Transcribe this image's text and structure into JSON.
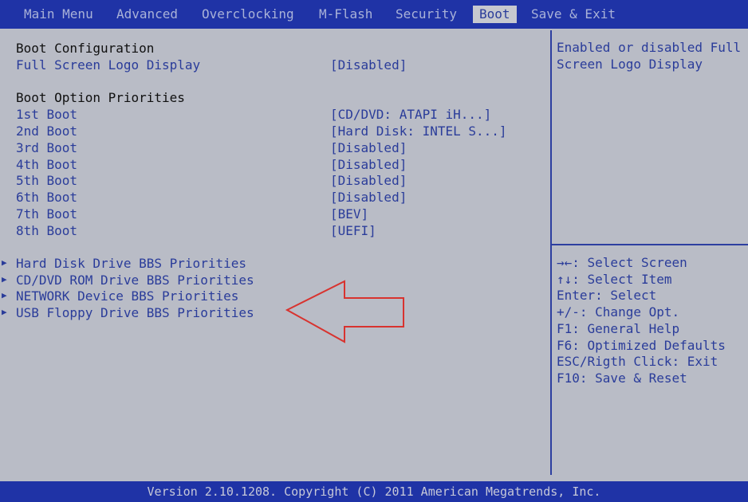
{
  "menu": {
    "items": [
      "Main Menu",
      "Advanced",
      "Overclocking",
      "M-Flash",
      "Security",
      "Boot",
      "Save & Exit"
    ],
    "active": "Boot"
  },
  "boot": {
    "config_header": "Boot Configuration",
    "full_screen_logo": {
      "label": "Full Screen Logo Display",
      "value": "[Disabled]"
    },
    "priorities_header": "Boot Option Priorities",
    "boot_options": [
      {
        "label": "1st Boot",
        "value": "[CD/DVD: ATAPI   iH...]"
      },
      {
        "label": "2nd Boot",
        "value": "[Hard Disk: INTEL S...]"
      },
      {
        "label": "3rd Boot",
        "value": "[Disabled]"
      },
      {
        "label": "4th Boot",
        "value": "[Disabled]"
      },
      {
        "label": "5th Boot",
        "value": "[Disabled]"
      },
      {
        "label": "6th Boot",
        "value": "[Disabled]"
      },
      {
        "label": "7th Boot",
        "value": "[BEV]"
      },
      {
        "label": "8th Boot",
        "value": "[UEFI]"
      }
    ],
    "submenus": [
      "Hard Disk Drive BBS Priorities",
      "CD/DVD ROM Drive BBS Priorities",
      "NETWORK Device BBS Priorities",
      "USB Floppy Drive BBS Priorities"
    ]
  },
  "help": {
    "description_line1": "Enabled or disabled Full",
    "description_line2": "Screen Logo Display",
    "keys": [
      "→←: Select Screen",
      "↑↓: Select Item",
      "Enter: Select",
      "+/-: Change Opt.",
      "F1: General Help",
      "F6: Optimized Defaults",
      "ESC/Rigth Click: Exit",
      "F10: Save & Reset"
    ]
  },
  "footer": {
    "text": "Version 2.10.1208. Copyright (C) 2011 American Megatrends, Inc."
  },
  "colors": {
    "menubar_bg": "#1f33a6",
    "panel_bg": "#b9bcc6",
    "text_blue": "#2a3c9a",
    "annotation_arrow": "#d8332f"
  }
}
